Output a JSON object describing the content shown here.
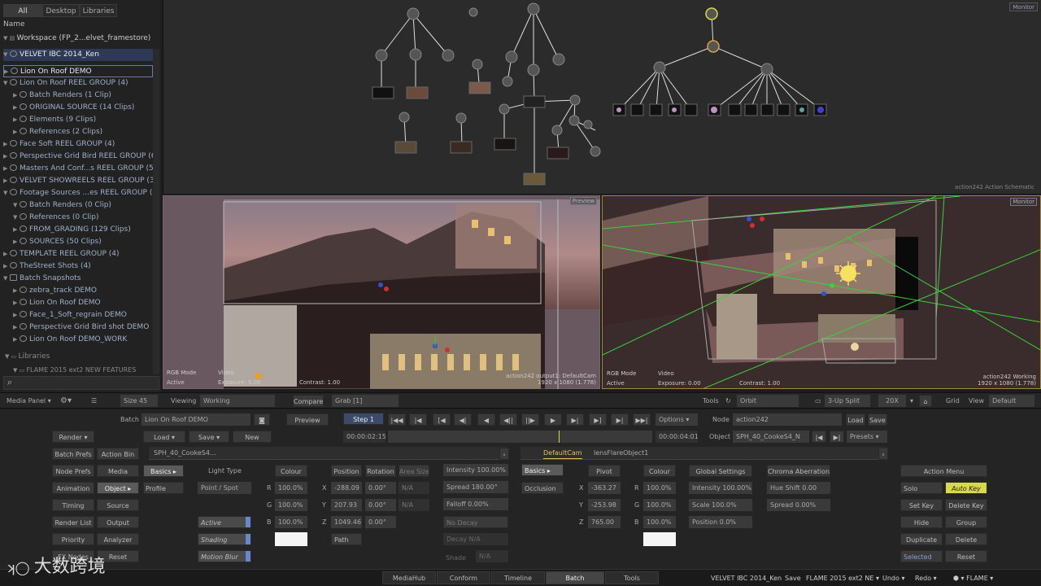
{
  "left_panel": {
    "tabs": [
      "All",
      "Desktop",
      "Libraries"
    ],
    "name_header": "Name",
    "workspace": "Workspace (FP_2...elvet_framestore)",
    "items": [
      "VELVET IBC 2014_Ken",
      "Lion On Roof DEMO",
      "Lion On Roof REEL GROUP (4)",
      "Batch Renders (1 Clip)",
      "ORIGINAL SOURCE (14 Clips)",
      "Elements (9 Clips)",
      "References (2 Clips)",
      "Face Soft REEL GROUP (4)",
      "Perspective Grid Bird REEL GROUP (6)",
      "Masters And Conf...s REEL GROUP (5)",
      "VELVET SHOWREELS REEL GROUP (3)",
      "Footage Sources ...es REEL GROUP (4)",
      "Batch Renders (0 Clip)",
      "References (0 Clip)",
      "FROM_GRADING (129 Clips)",
      "SOURCES (50 Clips)",
      "TEMPLATE REEL GROUP (4)",
      "TheStreet Shots (4)",
      "Batch Snapshots",
      "zebra_track DEMO",
      "Lion On Roof DEMO",
      "Face_1_Soft_regrain DEMO",
      "Perspective Grid Bird shot DEMO",
      "Lion On Roof DEMO_WORK"
    ],
    "libraries": "Libraries",
    "library_item": "FLAME 2015 ext2 NEW FEATURES"
  },
  "schematic": {
    "monitor": "Monitor",
    "label": "action242 Action Schematic"
  },
  "viewer1": {
    "tag": "Preview",
    "mode": "RGB Mode",
    "active": "Active",
    "video": "Video",
    "exposure": "Exposure: 0.00",
    "contrast": "Contrast: 1.00",
    "cam": "action242 output1: DefaultCam",
    "res": "1920 x 1080 (1.778)"
  },
  "viewer2": {
    "tag": "Monitor",
    "mode": "RGB Mode",
    "active": "Active",
    "video": "Video",
    "exposure": "Exposure: 0.00",
    "contrast": "Contrast: 1.00",
    "cam": "action242 Working",
    "res": "1920 x 1080 (1.778)"
  },
  "toolbar": {
    "media_panel": "Media Panel",
    "size": "Size 45",
    "viewing": "Viewing",
    "viewing_value": "Working",
    "compare": "Compare",
    "grab": "Grab [1]",
    "tools": "Tools",
    "orbit": "Orbit",
    "split": "3-Up Split",
    "zoom": "20X",
    "grid": "Grid",
    "view": "View",
    "view_value": "Default"
  },
  "batch": {
    "batch_label": "Batch",
    "batch_name": "Lion On Roof DEMO",
    "load": "Load",
    "save": "Save",
    "new": "New",
    "preview": "Preview",
    "step": "Step 1",
    "options": "Options",
    "node_label": "Node",
    "node_name": "action242",
    "node_load": "Load",
    "node_save": "Save",
    "object_label": "Object",
    "object_name": "SPH_40_CookeS4_N",
    "presets": "Presets",
    "tc_start": "00:00:02:15",
    "tc_end": "00:00:04:01"
  },
  "left_buttons": [
    "Render",
    "Batch Prefs",
    "Action Bin",
    "Node Prefs",
    "Media",
    "Animation",
    "Object",
    "Timing",
    "Source",
    "Render List",
    "Output",
    "Priority",
    "Analyzer",
    "FX Nodes",
    "Reset"
  ],
  "obj_panel": {
    "tab_name": "SPH_40_CookeS4...",
    "basics": "Basics",
    "profile": "Profile",
    "light_type": "Light Type",
    "point_spot": "Point / Spot",
    "active": "Active",
    "shading": "Shading",
    "motion_blur": "Motion Blur",
    "colour": "Colour",
    "r": "R",
    "g": "G",
    "b": "B",
    "r_val": "100.0%",
    "g_val": "100.0%",
    "b_val": "100.0%",
    "position": "Position",
    "rotation": "Rotation",
    "area_size": "Area Size",
    "x": "X",
    "y": "Y",
    "z": "Z",
    "px": "-288.09",
    "py": "207.93",
    "pz": "1049.46",
    "rx": "0.00°",
    "ry": "0.00°",
    "rz": "0.00°",
    "ax": "N/A",
    "ay": "N/A",
    "path": "Path",
    "intensity": "Intensity 100.00%",
    "spread": "Spread 180.00°",
    "falloff": "Falloff 0.00%",
    "no_decay": "No Decay",
    "decay": "Decay N/A",
    "shade": "Shade",
    "shade_val": "N/A"
  },
  "flare_panel": {
    "tab1": "DefaultCam",
    "tab2": "lensFlareObject1",
    "basics": "Basics",
    "occlusion": "Occlusion",
    "pivot": "Pivot",
    "x": "X",
    "y": "Y",
    "z": "Z",
    "px": "-363.27",
    "py": "-253.98",
    "pz": "765.00",
    "colour": "Colour",
    "r": "R",
    "g": "G",
    "b": "B",
    "r_val": "100.0%",
    "g_val": "100.0%",
    "b_val": "100.0%",
    "global": "Global Settings",
    "g_int": "Intensity 100.00%",
    "g_scale": "Scale 100.0%",
    "g_pos": "Position 0.0%",
    "chroma": "Chroma Aberration",
    "hue": "Hue Shift 0.00",
    "c_spread": "Spread 0.00%"
  },
  "action_menu": {
    "title": "Action Menu",
    "solo": "Solo",
    "auto_key": "Auto Key",
    "set_key": "Set Key",
    "delete_key": "Delete Key",
    "hide": "Hide",
    "group": "Group",
    "duplicate": "Duplicate",
    "delete": "Delete",
    "selected": "Selected",
    "reset": "Reset"
  },
  "bottom_tabs": [
    "MediaHub",
    "Conform",
    "Timeline",
    "Batch",
    "Tools"
  ],
  "status": {
    "project": "VELVET IBC 2014_Ken",
    "save": "Save",
    "version": "FLAME 2015 ext2 NE",
    "undo": "Undo",
    "redo": "Redo",
    "flame": "FLAME"
  },
  "watermark": "大数跨境"
}
